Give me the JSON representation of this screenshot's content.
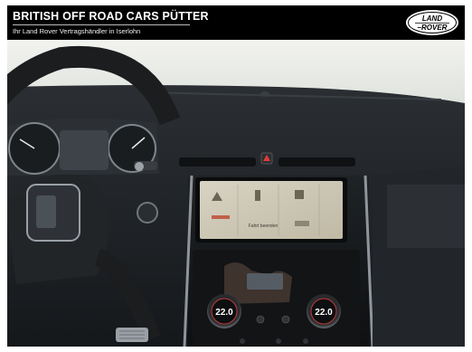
{
  "header": {
    "dealer_name": "BRITISH OFF ROAD CARS PÜTTER",
    "dealer_subtitle": "Ihr Land Rover Vertragshändler in Iserlohn",
    "logo_text_line1": "LAND",
    "logo_text_line2": "ROVER"
  },
  "screen": {
    "status_text": "Fahrt beenden"
  },
  "climate": {
    "left_temp": "22.0",
    "right_temp": "22.0"
  },
  "colors": {
    "header_bg": "#000000",
    "header_text": "#ffffff",
    "dashboard": "#1e2124",
    "glass": "#e9ece8"
  }
}
